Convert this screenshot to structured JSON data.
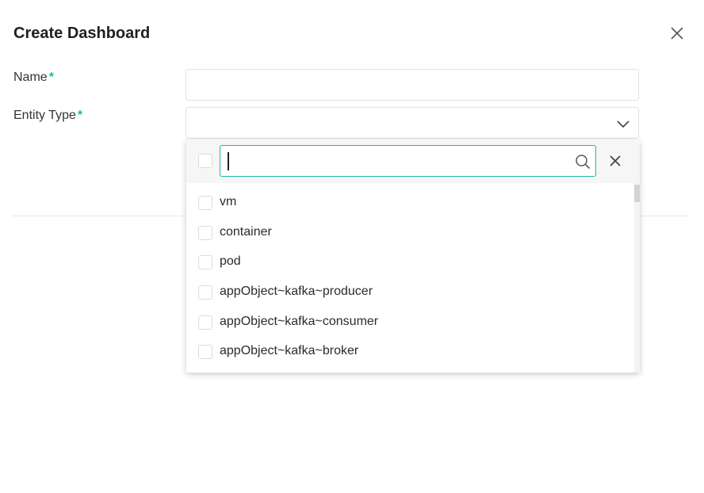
{
  "dialog": {
    "title": "Create Dashboard",
    "close_icon": "close-icon"
  },
  "form": {
    "name_label": "Name",
    "entity_type_label": "Entity Type",
    "required_marker": "*",
    "name_value": "",
    "entity_type_value": ""
  },
  "dropdown": {
    "search_value": "",
    "search_icon": "search-icon",
    "clear_icon": "close-icon",
    "items": [
      {
        "label": "vm",
        "checked": false
      },
      {
        "label": "container",
        "checked": false
      },
      {
        "label": "pod",
        "checked": false
      },
      {
        "label": "appObject~kafka~producer",
        "checked": false
      },
      {
        "label": "appObject~kafka~consumer",
        "checked": false
      },
      {
        "label": "appObject~kafka~broker",
        "checked": false
      }
    ]
  },
  "colors": {
    "accent": "#1fb7a6",
    "border": "#e2e2e2",
    "header_bg": "#f6f6f6"
  }
}
